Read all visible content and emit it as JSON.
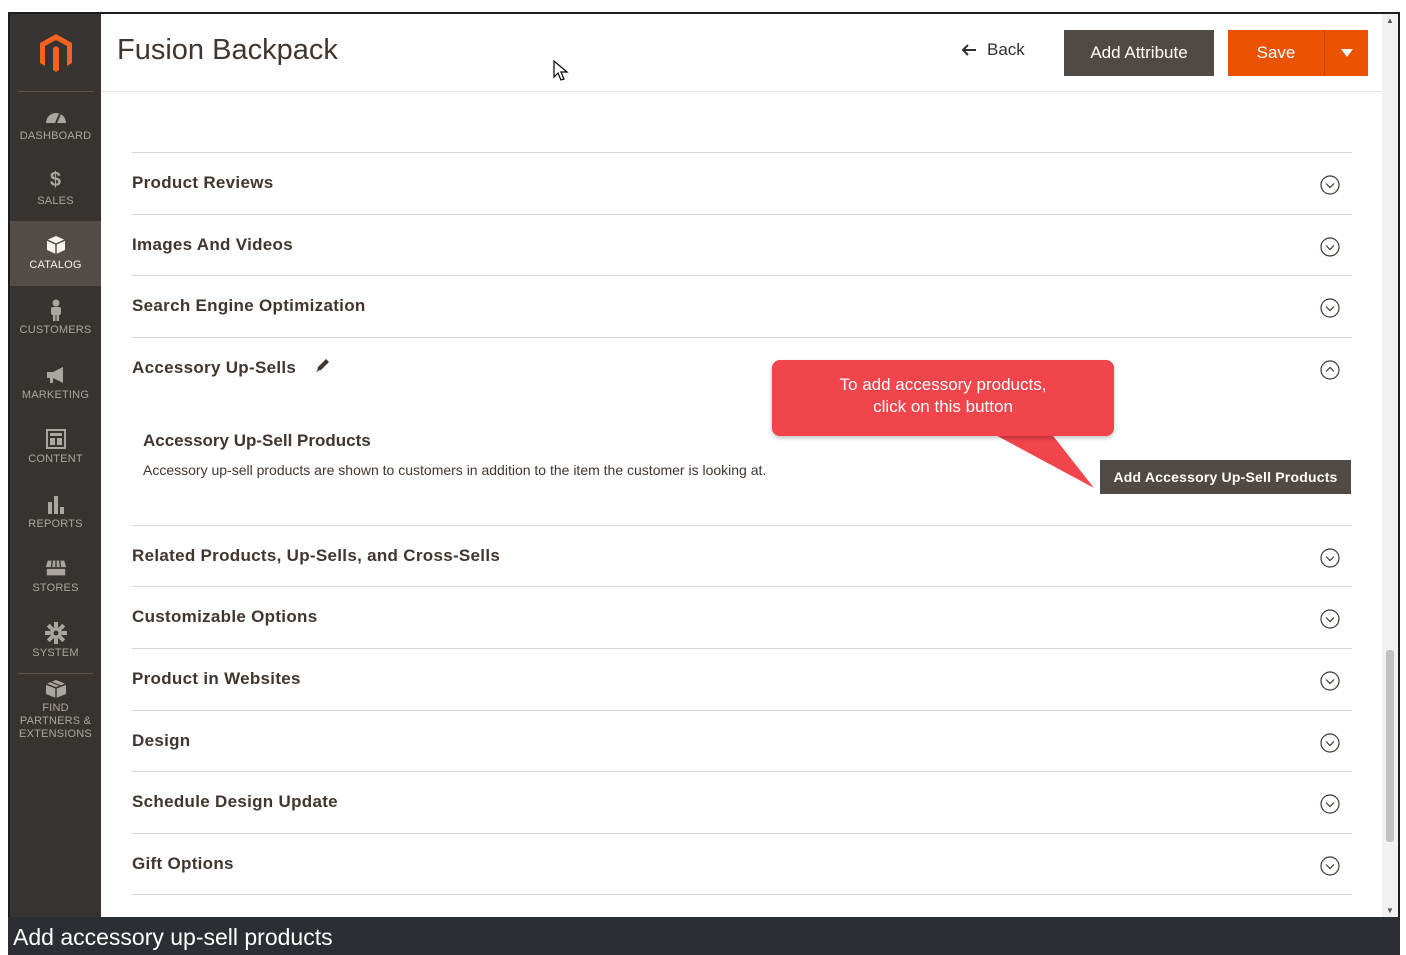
{
  "sidebar": {
    "items": [
      {
        "label": "DASHBOARD",
        "icon": "gauge-icon"
      },
      {
        "label": "SALES",
        "icon": "dollar-icon"
      },
      {
        "label": "CATALOG",
        "icon": "cube-icon",
        "active": true
      },
      {
        "label": "CUSTOMERS",
        "icon": "person-icon"
      },
      {
        "label": "MARKETING",
        "icon": "megaphone-icon"
      },
      {
        "label": "CONTENT",
        "icon": "layout-icon"
      },
      {
        "label": "REPORTS",
        "icon": "bar-chart-icon"
      },
      {
        "label": "STORES",
        "icon": "store-icon"
      },
      {
        "label": "SYSTEM",
        "icon": "gear-icon"
      },
      {
        "label": "FIND PARTNERS & EXTENSIONS",
        "icon": "box-icon"
      }
    ]
  },
  "header": {
    "title": "Fusion Backpack",
    "back_label": "Back",
    "add_attribute_label": "Add Attribute",
    "save_label": "Save"
  },
  "sections": [
    {
      "label": "Product Reviews",
      "state": "collapsed"
    },
    {
      "label": "Images And Videos",
      "state": "collapsed"
    },
    {
      "label": "Search Engine Optimization",
      "state": "collapsed"
    },
    {
      "label": "Accessory Up-Sells",
      "state": "expanded"
    },
    {
      "label": "Related Products, Up-Sells, and Cross-Sells",
      "state": "collapsed"
    },
    {
      "label": "Customizable Options",
      "state": "collapsed"
    },
    {
      "label": "Product in Websites",
      "state": "collapsed"
    },
    {
      "label": "Design",
      "state": "collapsed"
    },
    {
      "label": "Schedule Design Update",
      "state": "collapsed"
    },
    {
      "label": "Gift Options",
      "state": "collapsed"
    }
  ],
  "accessory": {
    "sub_title": "Accessory Up-Sell Products",
    "description": "Accessory up-sell products are shown to customers in addition to the item the customer is looking at.",
    "button_label": "Add Accessory Up-Sell Products"
  },
  "callout": {
    "line1": "To add accessory products,",
    "line2": "click on this button"
  },
  "caption": "Add accessory up-sell products",
  "colors": {
    "sidebar_bg": "#373330",
    "sidebar_active": "#524d49",
    "primary": "#eb5202",
    "secondary": "#514943",
    "callout": "#f1444b"
  }
}
